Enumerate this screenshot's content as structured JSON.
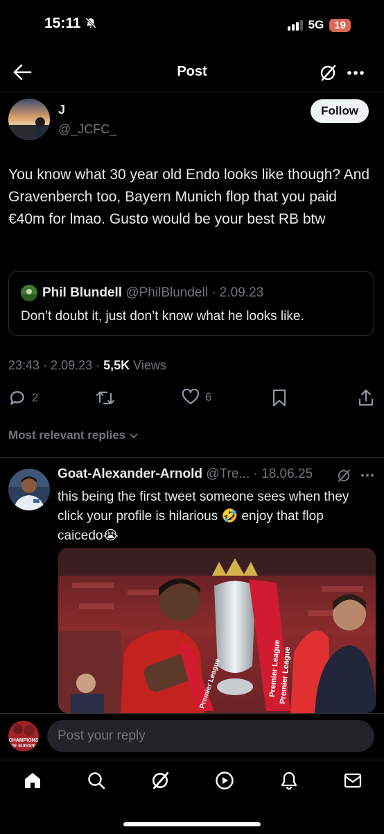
{
  "status_bar": {
    "time": "15:11",
    "network": "5G",
    "battery": "19"
  },
  "header": {
    "title": "Post"
  },
  "tweet": {
    "author_name": "J",
    "author_handle": "@_JCFC_",
    "follow_label": "Follow",
    "text": "You know what 30 year old Endo looks like though? And Gravenberch too, Bayern Munich flop that you paid €40m for lmao. Gusto would be your best RB btw",
    "quote": {
      "author_name": "Phil Blundell",
      "author_handle": "@PhilBlundell",
      "date": "· 2.09.23",
      "text": "Don’t doubt it, just don’t know what he looks like."
    },
    "time": "23:43",
    "date": "· 2.09.23 ·",
    "views_count": "5,5K",
    "views_label": "Views",
    "replies_count": "2",
    "likes_count": "6"
  },
  "sort": {
    "label": "Most relevant replies"
  },
  "reply": {
    "author_name": "Goat-Alexander-Arnold",
    "author_handle": "@Tre...",
    "date": "· 18.06.25",
    "text": "this being the first tweet someone sees when they click your profile is hilarious 🤣 enjoy that flop caicedo😭",
    "media_text": [
      "Premier League",
      "Premier League",
      "Premier League"
    ]
  },
  "composer": {
    "placeholder": "Post your reply",
    "avatar_text": [
      "CHAMPIONS",
      "OF EUROPE"
    ]
  },
  "colors": {
    "background": "#000000",
    "muted": "#71767b",
    "border": "#2f3336",
    "text": "#e7e9ea"
  },
  "icons": {
    "header": [
      "back-arrow-icon",
      "grok-icon",
      "more-dots-icon"
    ],
    "actions": [
      "reply-icon",
      "retweet-icon",
      "like-icon",
      "bookmark-icon",
      "share-icon"
    ],
    "tabs": [
      "home-icon",
      "search-icon",
      "grok-icon",
      "video-icon",
      "notifications-icon",
      "messages-icon"
    ]
  }
}
